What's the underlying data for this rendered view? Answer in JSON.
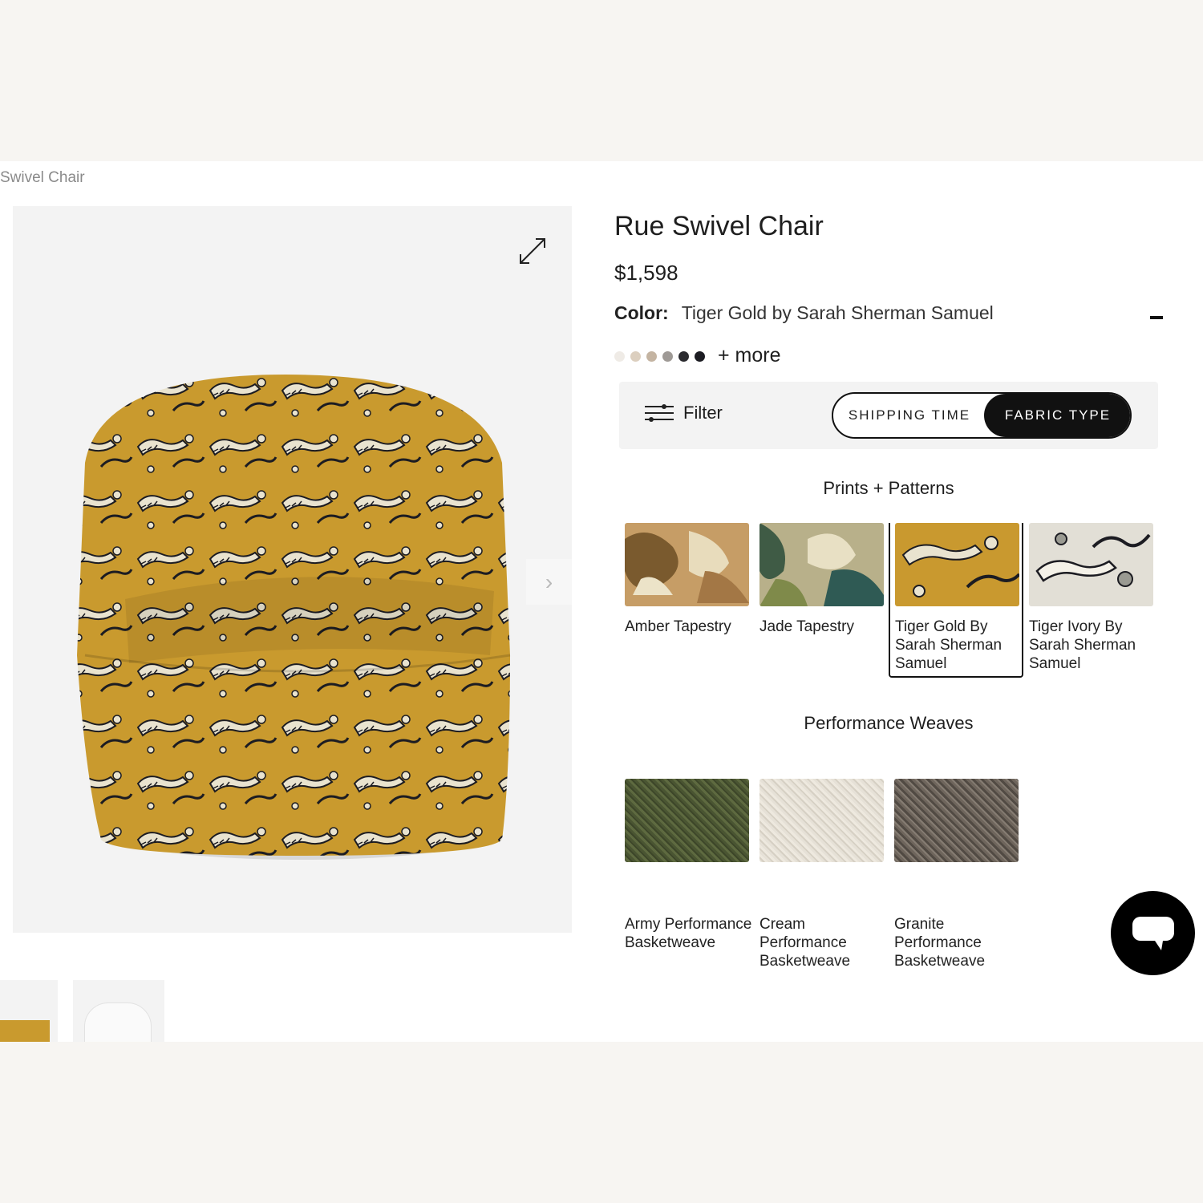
{
  "breadcrumb": "Swivel Chair",
  "product": {
    "title": "Rue Swivel Chair",
    "price": "$1,598",
    "color_label": "Color:",
    "color_value": "Tiger Gold by Sarah Sherman Samuel"
  },
  "color_dots": [
    "#efebe6",
    "#dccfbf",
    "#c4b4a2",
    "#9f9a96",
    "#2a2a2e",
    "#1c1c22"
  ],
  "more_label": "+ more",
  "filter": {
    "label": "Filter",
    "toggle": [
      "SHIPPING TIME",
      "FABRIC TYPE"
    ],
    "active": "FABRIC TYPE"
  },
  "sections": [
    {
      "heading": "Prints + Patterns",
      "swatches": [
        {
          "name": "Amber Tapestry",
          "color": "#b98e5a"
        },
        {
          "name": "Jade Tapestry",
          "color": "#8e9a6c"
        },
        {
          "name": "Tiger Gold By Sarah Sherman Samuel",
          "color": "#c9992f"
        },
        {
          "name": "Tiger Ivory By Sarah Sherman Samuel",
          "color": "#e2dfd6"
        }
      ]
    },
    {
      "heading": "Performance Weaves",
      "swatches": [
        {
          "name": "Army Performance Basketweave",
          "color": "#4f5a35"
        },
        {
          "name": "Cream Performance Basketweave",
          "color": "#e6e1d7"
        },
        {
          "name": "Granite Performance Basketweave",
          "color": "#6e655c"
        }
      ]
    }
  ],
  "selected_swatch": "Tiger Gold By Sarah Sherman Samuel",
  "icons": {
    "expand": "expand-icon",
    "next": "chevron-right-icon",
    "filter": "sliders-icon",
    "chat": "chat-icon"
  }
}
